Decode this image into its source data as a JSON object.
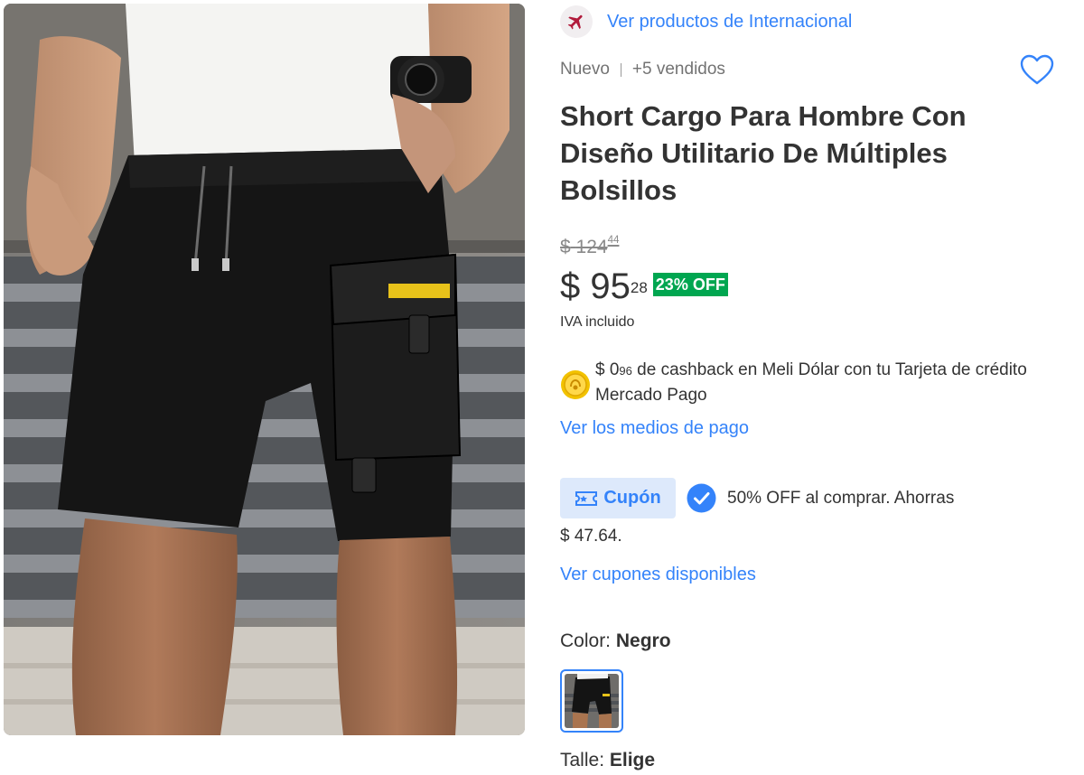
{
  "product_image": {
    "alt": "Short cargo negro para hombre"
  },
  "header": {
    "intl_icon": "airplane-icon",
    "intl_link": "Ver productos de Internacional"
  },
  "meta": {
    "condition": "Nuevo",
    "sold": "+5 vendidos",
    "favorite_icon": "heart-outline-icon"
  },
  "title": "Short Cargo Para Hombre Con Diseño Utilitario De Múltiples Bolsillos",
  "price": {
    "currency": "$",
    "old_integer": "124",
    "old_cents": "44",
    "current_integer": "95",
    "current_cents": "28",
    "discount_badge": "23% OFF",
    "tax_note": "IVA incluido"
  },
  "cashback": {
    "icon": "meli-dolar-coin-icon",
    "currency": "$ 0",
    "cents": "96",
    "text": " de cashback en Meli Dólar con tu Tarjeta de crédito Mercado Pago"
  },
  "payment_link": "Ver los medios de pago",
  "coupon": {
    "tag_icon": "coupon-ticket-icon",
    "tag_label": "Cupón",
    "check_icon": "check-circle-icon",
    "text": "50% OFF al comprar. Ahorras",
    "amount": "$ 47.64.",
    "link": "Ver cupones disponibles"
  },
  "variations": {
    "color_label": "Color:",
    "color_value": "Negro",
    "size_label": "Talle:",
    "size_value": "Elige"
  },
  "colors": {
    "accent": "#3483fa",
    "discount": "#00a650",
    "text": "#333333",
    "muted": "#737373"
  }
}
